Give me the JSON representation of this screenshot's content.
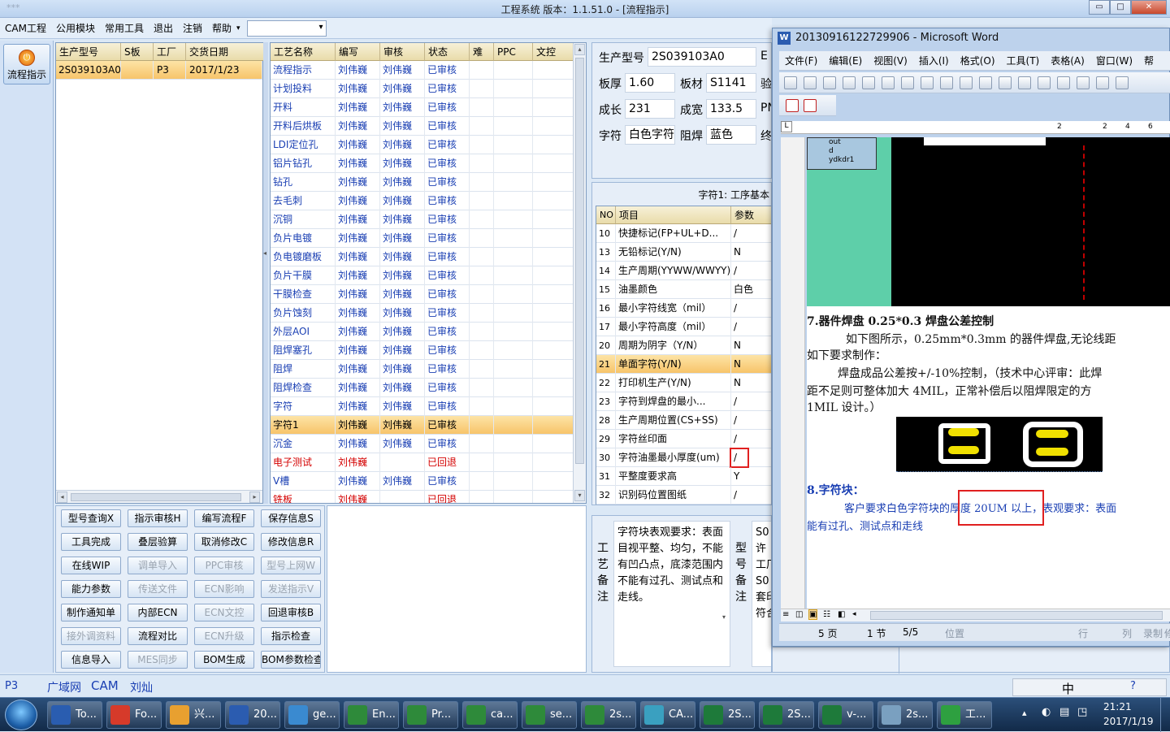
{
  "app": {
    "title": "工程系统   版本：1.1.51.0 - [流程指示]",
    "title_left_faded": "***",
    "menu": [
      "CAM工程",
      "公用模块",
      "常用工具",
      "退出",
      "注销",
      "帮助"
    ],
    "flow_button": "流程指示"
  },
  "orders": {
    "headers": [
      "生产型号",
      "S板",
      "工厂",
      "交货日期"
    ],
    "rows": [
      {
        "model": "2S039103A0",
        "s": "",
        "factory": "P3",
        "date": "2017/1/23"
      }
    ]
  },
  "process": {
    "headers": [
      "工艺名称",
      "编写",
      "审核",
      "状态",
      "难",
      "PPC",
      "文控"
    ],
    "rows": [
      {
        "name": "流程指示",
        "w": "刘伟巍",
        "r": "刘伟巍",
        "s": "已审核",
        "c": "blue"
      },
      {
        "name": "计划投料",
        "w": "刘伟巍",
        "r": "刘伟巍",
        "s": "已审核",
        "c": "blue"
      },
      {
        "name": "开料",
        "w": "刘伟巍",
        "r": "刘伟巍",
        "s": "已审核",
        "c": "blue"
      },
      {
        "name": "开料后烘板",
        "w": "刘伟巍",
        "r": "刘伟巍",
        "s": "已审核",
        "c": "blue"
      },
      {
        "name": "LDI定位孔",
        "w": "刘伟巍",
        "r": "刘伟巍",
        "s": "已审核",
        "c": "blue"
      },
      {
        "name": "铝片钻孔",
        "w": "刘伟巍",
        "r": "刘伟巍",
        "s": "已审核",
        "c": "blue"
      },
      {
        "name": "钻孔",
        "w": "刘伟巍",
        "r": "刘伟巍",
        "s": "已审核",
        "c": "blue"
      },
      {
        "name": "去毛刺",
        "w": "刘伟巍",
        "r": "刘伟巍",
        "s": "已审核",
        "c": "blue"
      },
      {
        "name": "沉铜",
        "w": "刘伟巍",
        "r": "刘伟巍",
        "s": "已审核",
        "c": "blue"
      },
      {
        "name": "负片电镀",
        "w": "刘伟巍",
        "r": "刘伟巍",
        "s": "已审核",
        "c": "blue"
      },
      {
        "name": "负电镀磨板",
        "w": "刘伟巍",
        "r": "刘伟巍",
        "s": "已审核",
        "c": "blue"
      },
      {
        "name": "负片干膜",
        "w": "刘伟巍",
        "r": "刘伟巍",
        "s": "已审核",
        "c": "blue"
      },
      {
        "name": "干膜检查",
        "w": "刘伟巍",
        "r": "刘伟巍",
        "s": "已审核",
        "c": "blue"
      },
      {
        "name": "负片蚀刻",
        "w": "刘伟巍",
        "r": "刘伟巍",
        "s": "已审核",
        "c": "blue"
      },
      {
        "name": "外层AOI",
        "w": "刘伟巍",
        "r": "刘伟巍",
        "s": "已审核",
        "c": "blue"
      },
      {
        "name": "阻焊塞孔",
        "w": "刘伟巍",
        "r": "刘伟巍",
        "s": "已审核",
        "c": "blue"
      },
      {
        "name": "阻焊",
        "w": "刘伟巍",
        "r": "刘伟巍",
        "s": "已审核",
        "c": "blue"
      },
      {
        "name": "阻焊检查",
        "w": "刘伟巍",
        "r": "刘伟巍",
        "s": "已审核",
        "c": "blue"
      },
      {
        "name": "字符",
        "w": "刘伟巍",
        "r": "刘伟巍",
        "s": "已审核",
        "c": "blue"
      },
      {
        "name": "字符1",
        "w": "刘伟巍",
        "r": "刘伟巍",
        "s": "已审核",
        "c": "blue",
        "sel": true
      },
      {
        "name": "沉金",
        "w": "刘伟巍",
        "r": "刘伟巍",
        "s": "已审核",
        "c": "blue"
      },
      {
        "name": "电子测试",
        "w": "刘伟巍",
        "r": "",
        "s": "已回退",
        "c": "red"
      },
      {
        "name": "V槽",
        "w": "刘伟巍",
        "r": "刘伟巍",
        "s": "已审核",
        "c": "blue"
      },
      {
        "name": "铣板",
        "w": "刘伟巍",
        "r": "",
        "s": "已回退",
        "c": "red"
      }
    ]
  },
  "buttons": [
    [
      "型号查询X",
      "指示审核H",
      "编写流程F",
      "保存信息S"
    ],
    [
      "工具完成",
      "叠层验算",
      "取消修改C",
      "修改信息R"
    ],
    [
      "在线WIP",
      "调单导入",
      "PPC审核",
      "型号上网W"
    ],
    [
      "能力参数",
      "传送文件",
      "ECN影响",
      "发送指示V"
    ],
    [
      "制作通知单",
      "内部ECN",
      "ECN文控",
      "回退审核B"
    ],
    [
      "接外调资料",
      "流程对比",
      "ECN升级",
      "指示检查"
    ],
    [
      "信息导入",
      "MES同步",
      "BOM生成",
      "BOM参数检查"
    ]
  ],
  "disabled_buttons": [
    "调单导入",
    "PPC审核",
    "型号上网W",
    "传送文件",
    "ECN影响",
    "发送指示V",
    "ECN文控",
    "接外调资料",
    "ECN升级",
    "MES同步"
  ],
  "info": {
    "model_label": "生产型号",
    "model": "2S039103A0",
    "model_extra": "E",
    "thick_label": "板厚",
    "thick": "1.60",
    "mat_label": "板材",
    "mat": "S1141",
    "v_label": "验",
    "len_label": "成长",
    "len": "231",
    "wid_label": "成宽",
    "wid": "133.5",
    "pn_label": "PN",
    "char_label": "字符",
    "char": "白色字符",
    "mask_label": "阻焊",
    "mask": "蓝色",
    "end_label": "终"
  },
  "params": {
    "caption": "字符1: 工序基本",
    "headers": [
      "NO",
      "项目",
      "参数"
    ],
    "rows": [
      {
        "no": "10",
        "item": "快捷标记(FP+UL+D...",
        "val": "/"
      },
      {
        "no": "13",
        "item": "无铅标记(Y/N)",
        "val": "N"
      },
      {
        "no": "14",
        "item": "生产周期(YYWW/WWYY)",
        "val": "/"
      },
      {
        "no": "15",
        "item": "油墨颜色",
        "val": "白色"
      },
      {
        "no": "16",
        "item": "最小字符线宽（mil）",
        "val": "/"
      },
      {
        "no": "17",
        "item": "最小字符高度（mil）",
        "val": "/"
      },
      {
        "no": "20",
        "item": "周期为阴字（Y/N）",
        "val": "N"
      },
      {
        "no": "21",
        "item": "单面字符(Y/N)",
        "val": "N",
        "sel": true
      },
      {
        "no": "22",
        "item": "打印机生产(Y/N)",
        "val": "N"
      },
      {
        "no": "23",
        "item": "字符到焊盘的最小...",
        "val": "/"
      },
      {
        "no": "28",
        "item": "生产周期位置(CS+SS)",
        "val": "/"
      },
      {
        "no": "29",
        "item": "字符丝印面",
        "val": "/"
      },
      {
        "no": "30",
        "item": "字符油墨最小厚度(um)",
        "val": "/",
        "boxed": true
      },
      {
        "no": "31",
        "item": "平整度要求高",
        "val": "Y"
      },
      {
        "no": "32",
        "item": "识别码位置图纸",
        "val": "/"
      }
    ]
  },
  "notes": {
    "label": "工艺备注",
    "text": "字符块表观要求：表面目视平整、均匀，不能有凹凸点，底漆范围内不能有过孔、测试点和走线。",
    "label2": "型号备注",
    "text2_lines": [
      "S0",
      "许",
      "工厂",
      "S0",
      "套印",
      "符合"
    ]
  },
  "word": {
    "title": "20130916122729906 - Microsoft Word",
    "menu": [
      "文件(F)",
      "编辑(E)",
      "视图(V)",
      "插入(I)",
      "格式(O)",
      "工具(T)",
      "表格(A)",
      "窗口(W)",
      "帮"
    ],
    "ruler": [
      "2",
      "2",
      "4",
      "6"
    ],
    "cad_items": [
      "out",
      "d",
      "ydkdr1"
    ],
    "h7": "7.器件焊盘 0.25*0.3 焊盘公差控制",
    "p7a": "如下图所示，0.25mm*0.3mm 的器件焊盘,无论线距",
    "p7b": "如下要求制作：",
    "p7c": "焊盘成品公差按+/-10%控制，（技术中心评审：此焊",
    "p7d": "距不足则可整体加大 4MIL，正常补偿后以阻焊限定的方",
    "p7e": "1MIL 设计。）",
    "h8": "8.字符块：",
    "p8a_pre": "客户要求白色字符块的",
    "p8a_hl": "厚度 20UM 以上",
    "p8a_post": "，表观要求：表面",
    "p8b": "能有过孔、测试点和走线",
    "status": {
      "page": "5 页",
      "section": "1 节",
      "pages": "5/5",
      "pos": "位置",
      "line": "行",
      "col": "列",
      "rec": "录制",
      "extra": "修"
    }
  },
  "statusrow": {
    "items": [
      "P3",
      "广域网",
      "CAM",
      "刘灿"
    ]
  },
  "taskbar": {
    "items": [
      "To...",
      "Fo...",
      "兴...",
      "20...",
      "ge...",
      "En...",
      "Pr...",
      "ca...",
      "se...",
      "2s...",
      "CA...",
      "2S...",
      "2S...",
      "v-...",
      "2s...",
      "工..."
    ],
    "time": "21:21",
    "date": "2017/1/19",
    "ime": "中"
  },
  "colors": {
    "accent": "#1a3fb3",
    "returned": "#d40000",
    "selected": "#f7c46a",
    "highlight_box": "#e02020"
  }
}
